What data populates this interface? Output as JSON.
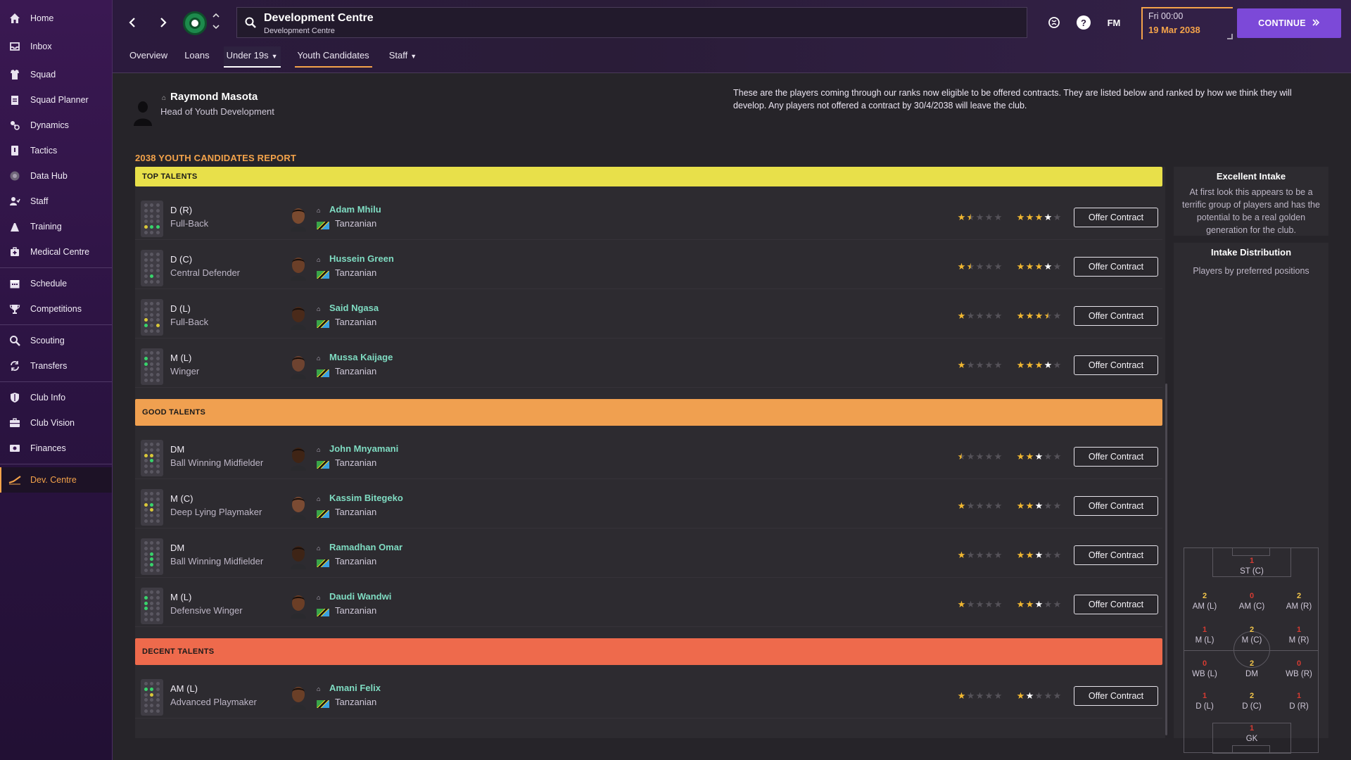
{
  "sidebar": {
    "items": [
      {
        "label": "Home",
        "icon": "home-icon"
      },
      {
        "label": "Inbox",
        "icon": "inbox-icon"
      },
      {
        "label": "Squad",
        "icon": "squad-icon"
      },
      {
        "label": "Squad Planner",
        "icon": "clipboard-icon"
      },
      {
        "label": "Dynamics",
        "icon": "dynamics-icon"
      },
      {
        "label": "Tactics",
        "icon": "tactics-icon"
      },
      {
        "label": "Data Hub",
        "icon": "data-hub-icon"
      },
      {
        "label": "Staff",
        "icon": "staff-icon"
      },
      {
        "label": "Training",
        "icon": "training-icon"
      },
      {
        "label": "Medical Centre",
        "icon": "medical-icon"
      },
      {
        "label": "Schedule",
        "icon": "calendar-icon"
      },
      {
        "label": "Competitions",
        "icon": "trophy-icon"
      },
      {
        "label": "Scouting",
        "icon": "scouting-icon"
      },
      {
        "label": "Transfers",
        "icon": "transfers-icon"
      },
      {
        "label": "Club Info",
        "icon": "shield-icon"
      },
      {
        "label": "Club Vision",
        "icon": "vision-icon"
      },
      {
        "label": "Finances",
        "icon": "finances-icon"
      },
      {
        "label": "Dev. Centre",
        "icon": "dev-centre-icon"
      }
    ]
  },
  "header": {
    "title": "Development Centre",
    "subtitle": "Development Centre",
    "date_line1": "Fri 00:00",
    "date_line2": "19 Mar 2038",
    "fm_label": "FM",
    "continue_label": "CONTINUE",
    "tabs": [
      {
        "label": "Overview"
      },
      {
        "label": "Loans"
      },
      {
        "label": "Under 19s"
      },
      {
        "label": "Youth Candidates"
      },
      {
        "label": "Staff"
      }
    ]
  },
  "head_of_youth": {
    "name": "Raymond Masota",
    "role": "Head of Youth Development"
  },
  "intro_text": "These are the players coming through our ranks now eligible to be offered contracts. They are listed below and ranked by how we think they will develop. Any players not offered a contract by 30/4/2038 will leave the club.",
  "report_title": "2038 YOUTH CANDIDATES REPORT",
  "colors": {
    "top_talents": "#e8e04a",
    "good_talents": "#f0a050",
    "decent_talents": "#ee6a4c",
    "accent": "#f4a34a",
    "continue": "#7c49d8",
    "player_name": "#7fdcc2"
  },
  "offer_label": "Offer Contract",
  "sections": [
    {
      "label": "TOP TALENTS",
      "players": [
        {
          "pos": "D (R)",
          "role": "Full-Back",
          "name": "Adam Mhilu",
          "nationality": "Tanzanian",
          "ca_stars": 1.5,
          "pa_stars": 4
        },
        {
          "pos": "D (C)",
          "role": "Central Defender",
          "name": "Hussein Green",
          "nationality": "Tanzanian",
          "ca_stars": 1.5,
          "pa_stars": 4
        },
        {
          "pos": "D (L)",
          "role": "Full-Back",
          "name": "Said Ngasa",
          "nationality": "Tanzanian",
          "ca_stars": 1,
          "pa_stars": 3.5
        },
        {
          "pos": "M (L)",
          "role": "Winger",
          "name": "Mussa Kaijage",
          "nationality": "Tanzanian",
          "ca_stars": 1,
          "pa_stars": 4
        }
      ]
    },
    {
      "label": "GOOD TALENTS",
      "players": [
        {
          "pos": "DM",
          "role": "Ball Winning Midfielder",
          "name": "John Mnyamani",
          "nationality": "Tanzanian",
          "ca_stars": 0.5,
          "pa_stars": 3
        },
        {
          "pos": "M (C)",
          "role": "Deep Lying Playmaker",
          "name": "Kassim Bitegeko",
          "nationality": "Tanzanian",
          "ca_stars": 1,
          "pa_stars": 3
        },
        {
          "pos": "DM",
          "role": "Ball Winning Midfielder",
          "name": "Ramadhan Omar",
          "nationality": "Tanzanian",
          "ca_stars": 1,
          "pa_stars": 3
        },
        {
          "pos": "M (L)",
          "role": "Defensive Winger",
          "name": "Daudi Wandwi",
          "nationality": "Tanzanian",
          "ca_stars": 1,
          "pa_stars": 3
        }
      ]
    },
    {
      "label": "DECENT TALENTS",
      "players": [
        {
          "pos": "AM (L)",
          "role": "Advanced Playmaker",
          "name": "Amani Felix",
          "nationality": "Tanzanian",
          "ca_stars": 1,
          "pa_stars": 2
        }
      ]
    }
  ],
  "right_panel": {
    "intake_title": "Excellent Intake",
    "intake_text": "At first look this appears to be a terrific group of players and has the potential to be a real golden generation for the club.",
    "dist_title": "Intake Distribution",
    "dist_subtitle": "Players by preferred positions",
    "positions": [
      {
        "label": "ST (C)",
        "count": "1"
      },
      {
        "label": "AM (L)",
        "count": "2"
      },
      {
        "label": "AM (C)",
        "count": "0"
      },
      {
        "label": "AM (R)",
        "count": "2"
      },
      {
        "label": "M (L)",
        "count": "1"
      },
      {
        "label": "M (C)",
        "count": "2"
      },
      {
        "label": "M (R)",
        "count": "1"
      },
      {
        "label": "WB (L)",
        "count": "0"
      },
      {
        "label": "DM",
        "count": "2"
      },
      {
        "label": "WB (R)",
        "count": "0"
      },
      {
        "label": "D (L)",
        "count": "1"
      },
      {
        "label": "D (C)",
        "count": "2"
      },
      {
        "label": "D (R)",
        "count": "1"
      },
      {
        "label": "GK",
        "count": "1"
      }
    ]
  }
}
